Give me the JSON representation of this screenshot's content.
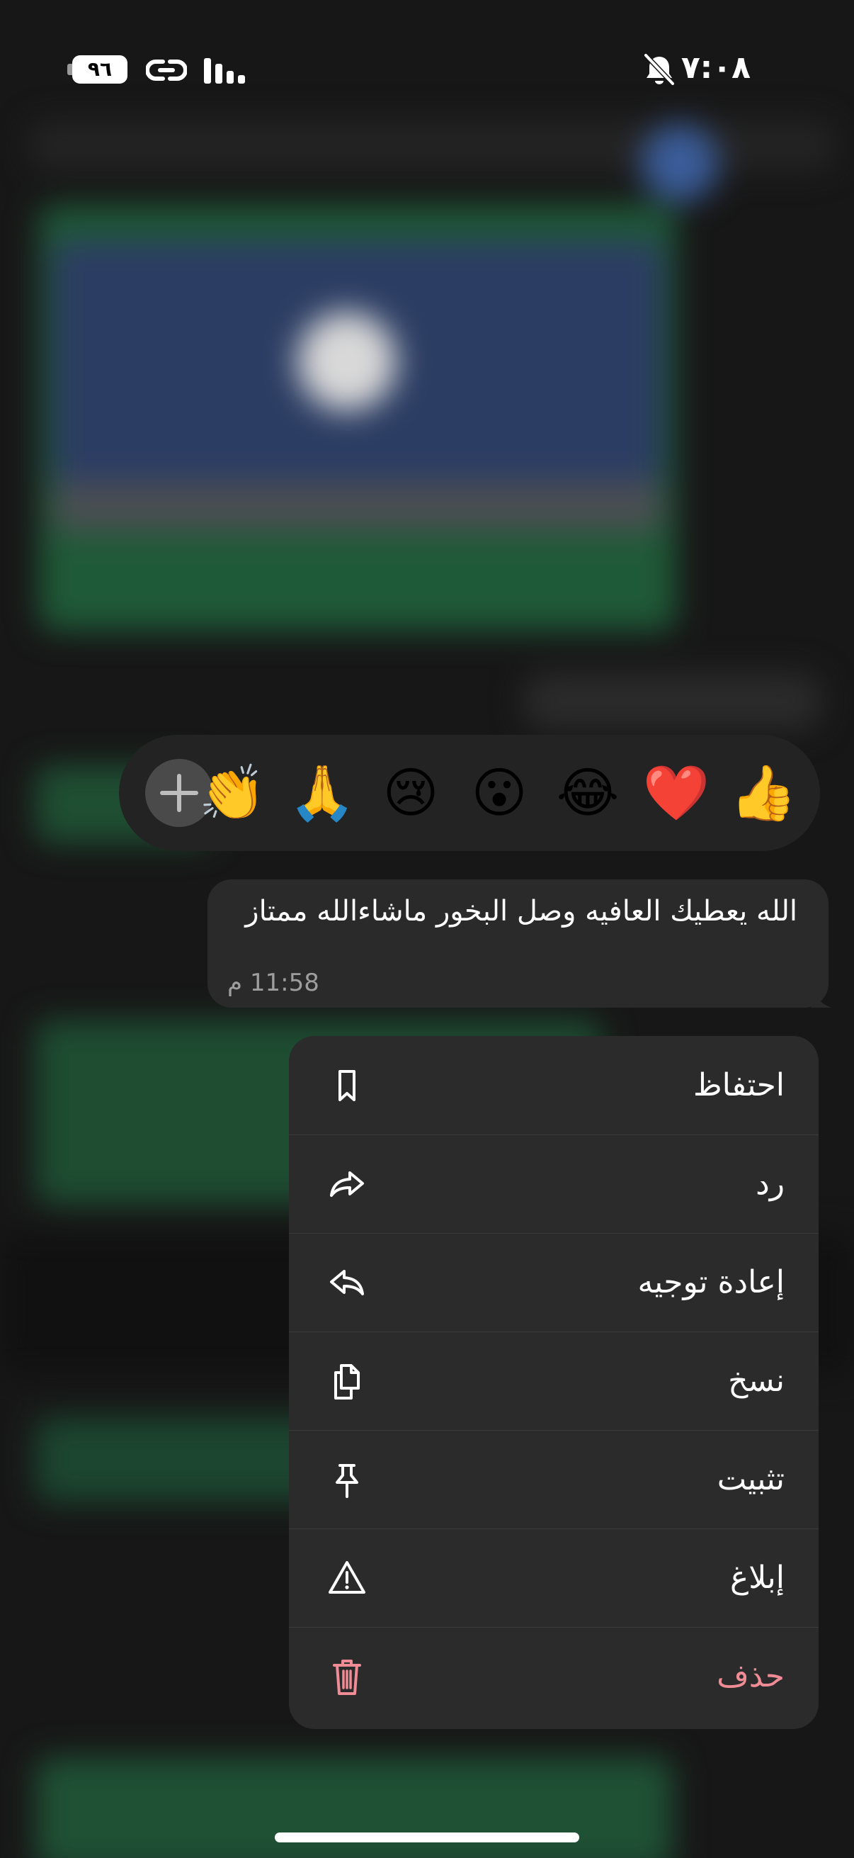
{
  "status_bar": {
    "time": "٧:٠٨",
    "battery": "٩٦",
    "icons": [
      "bell-slash-icon",
      "link-icon",
      "signal-icon"
    ]
  },
  "reactions": {
    "emojis": [
      "👍",
      "❤️",
      "😂",
      "😮",
      "😢",
      "🙏",
      "👏"
    ],
    "add_icon": "plus-icon"
  },
  "message": {
    "text": "الله يعطيك العافيه وصل البخور ماشاءالله ممتاز",
    "time": "11:58 م"
  },
  "menu": {
    "items": [
      {
        "label": "احتفاظ",
        "icon": "bookmark-icon"
      },
      {
        "label": "رد",
        "icon": "reply-icon"
      },
      {
        "label": "إعادة توجيه",
        "icon": "forward-icon"
      },
      {
        "label": "نسخ",
        "icon": "copy-icon"
      },
      {
        "label": "تثبيت",
        "icon": "pin-icon"
      },
      {
        "label": "إبلاغ",
        "icon": "warning-icon"
      },
      {
        "label": "حذف",
        "icon": "trash-icon"
      }
    ]
  },
  "colors": {
    "danger": "#f08c95",
    "menu_bg": "#2b2b2b",
    "bubble_bg": "#2a2a2a"
  }
}
